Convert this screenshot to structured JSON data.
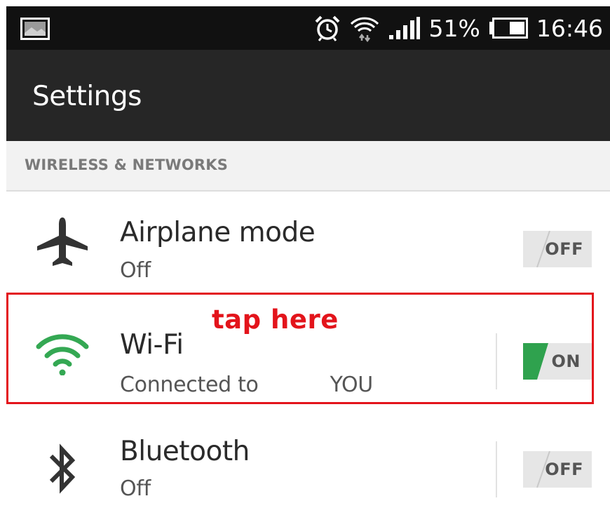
{
  "status_bar": {
    "battery_percent": "51%",
    "battery_level": 0.51,
    "time": "16:46",
    "icons": [
      "image-notification-icon",
      "alarm-icon",
      "wifi-icon",
      "signal-icon",
      "battery-icon"
    ]
  },
  "action_bar": {
    "title": "Settings"
  },
  "section": {
    "header": "WIRELESS & NETWORKS"
  },
  "rows": [
    {
      "title": "Airplane mode",
      "subtitle": "Off",
      "toggle": "OFF",
      "icon": "airplane-icon"
    },
    {
      "title": "Wi-Fi",
      "subtitle_prefix": "Connected to",
      "subtitle_network": "YOU",
      "toggle": "ON",
      "icon": "wifi-icon"
    },
    {
      "title": "Bluetooth",
      "subtitle": "Off",
      "toggle": "OFF",
      "icon": "bluetooth-icon"
    }
  ],
  "annotation": {
    "text": "tap here",
    "color": "#e3141b"
  },
  "colors": {
    "wifi_on": "#34a853",
    "toggle_on": "#2fa24e",
    "status_bar": "#111111",
    "action_bar": "#262626"
  }
}
